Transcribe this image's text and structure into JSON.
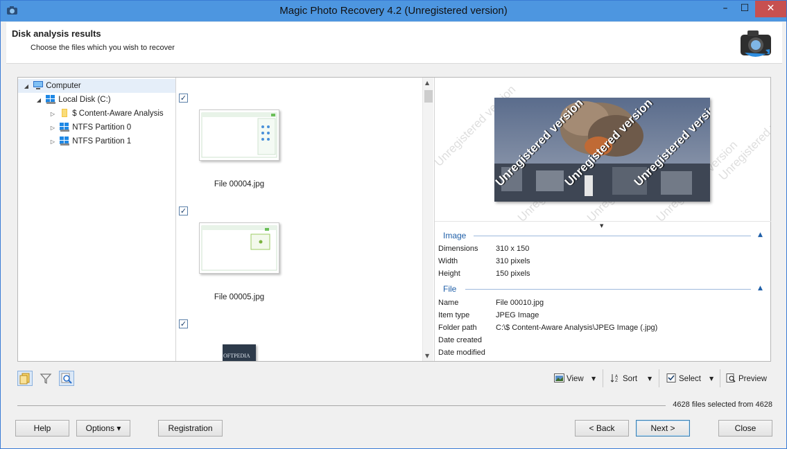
{
  "window": {
    "title": "Magic Photo Recovery 4.2 (Unregistered version)",
    "min_glyph": "–",
    "max_glyph": "☐",
    "close_glyph": "✕"
  },
  "header": {
    "title": "Disk analysis results",
    "subtitle": "Choose the files which you wish to recover"
  },
  "tree": {
    "items": [
      {
        "label": "Computer",
        "level": 0,
        "expanded": true,
        "icon": "computer-icon"
      },
      {
        "label": "Local Disk (C:)",
        "level": 1,
        "expanded": true,
        "icon": "disk-icon"
      },
      {
        "label": "$ Content-Aware Analysis",
        "level": 2,
        "expanded": false,
        "icon": "folder-icon"
      },
      {
        "label": "NTFS Partition 0",
        "level": 2,
        "expanded": false,
        "icon": "partition-icon"
      },
      {
        "label": "NTFS Partition 1",
        "level": 2,
        "expanded": false,
        "icon": "partition-icon"
      }
    ]
  },
  "files": [
    {
      "name": "File 00004.jpg",
      "checked": true
    },
    {
      "name": "File 00005.jpg",
      "checked": true
    },
    {
      "name": "",
      "checked": true,
      "thumb_text": "OFTPEDIA"
    }
  ],
  "preview": {
    "watermark": "Unregistered version",
    "image_section": {
      "title": "Image",
      "props": [
        {
          "key": "Dimensions",
          "value": "310 x 150"
        },
        {
          "key": "Width",
          "value": "310 pixels"
        },
        {
          "key": "Height",
          "value": "150 pixels"
        }
      ]
    },
    "file_section": {
      "title": "File",
      "props": [
        {
          "key": "Name",
          "value": "File 00010.jpg"
        },
        {
          "key": "Item type",
          "value": "JPEG Image"
        },
        {
          "key": "Folder path",
          "value": "C:\\$ Content-Aware Analysis\\JPEG Image (.jpg)"
        },
        {
          "key": "Date created",
          "value": ""
        },
        {
          "key": "Date modified",
          "value": ""
        }
      ]
    }
  },
  "toolbar": {
    "view_label": "View",
    "sort_label": "Sort",
    "select_label": "Select",
    "preview_label": "Preview"
  },
  "status": {
    "text": "4628 files selected from 4628"
  },
  "buttons": {
    "help": "Help",
    "options": "Options ▾",
    "registration": "Registration",
    "back": "< Back",
    "next": "Next >",
    "close": "Close"
  },
  "colors": {
    "titlebar": "#4d96e0",
    "accent": "#1f5fa8",
    "close_button": "#c75050"
  }
}
